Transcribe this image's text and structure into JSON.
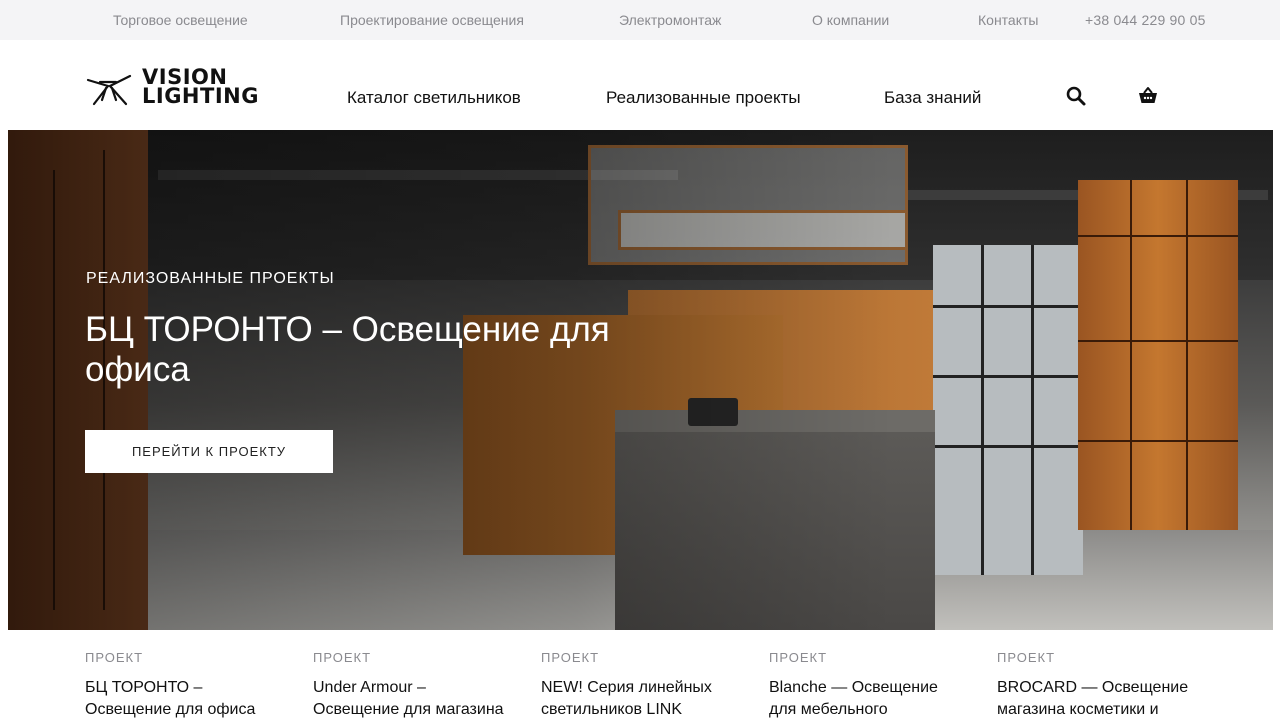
{
  "topbar": {
    "links": [
      "Торговое освещение",
      "Проектирование освещения",
      "Электромонтаж",
      "О компании",
      "Контакты"
    ],
    "phone": "+38 044 229 90 05"
  },
  "header": {
    "logo_line1": "VISION",
    "logo_line2": "LIGHTING",
    "nav": [
      "Каталог светильников",
      "Реализованные проекты",
      "База знаний"
    ],
    "icons": [
      "search-icon",
      "cart-icon"
    ]
  },
  "hero": {
    "eyebrow": "РЕАЛИЗОВАННЫЕ ПРОЕКТЫ",
    "title": "БЦ ТОРОНТО – Освещение для офиса",
    "cta_label": "ПЕРЕЙТИ К ПРОЕКТУ"
  },
  "projects": [
    {
      "kicker": "ПРОЕКТ",
      "title": "БЦ ТОРОНТО – Освещение для офиса"
    },
    {
      "kicker": "ПРОЕКТ",
      "title": "Under Armour – Освещение для магазина"
    },
    {
      "kicker": "ПРОЕКТ",
      "title": "NEW! Серия линейных светильников LINK"
    },
    {
      "kicker": "ПРОЕКТ",
      "title": "Blanche — Освещение для мебельного"
    },
    {
      "kicker": "ПРОЕКТ",
      "title": "BROCARD — Освещение магазина косметики и"
    }
  ],
  "colors": {
    "topbar_bg": "#f4f4f6",
    "muted_text": "#8a8a8f",
    "text": "#111111",
    "cta_bg": "#ffffff"
  }
}
